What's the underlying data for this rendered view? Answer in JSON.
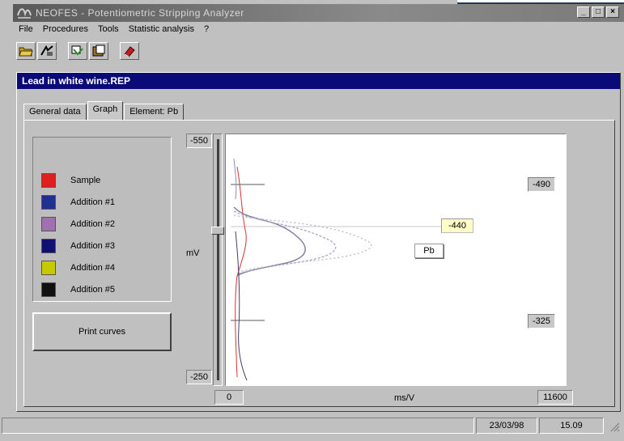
{
  "app": {
    "title": "NEOFES - Potentiometric Stripping Analyzer"
  },
  "window_controls": {
    "minimize": "_",
    "maximize": "□",
    "close": "×"
  },
  "menu": [
    "File",
    "Procedures",
    "Tools",
    "Statistic analysis",
    "?"
  ],
  "toolbar": {
    "icons": [
      "open-folder-icon",
      "scan-icon",
      "copy-icon",
      "paste-icon",
      "clear-icon"
    ]
  },
  "document": {
    "title": "Lead in white wine.REP",
    "tabs": [
      "General data",
      "Graph",
      "Element: Pb"
    ],
    "active_tab": "Graph"
  },
  "legend": {
    "items": [
      {
        "label": "Sample",
        "color": "#e02020"
      },
      {
        "label": "Addition #1",
        "color": "#1e3090"
      },
      {
        "label": "Addition #2",
        "color": "#a070b0"
      },
      {
        "label": "Addition #3",
        "color": "#101070"
      },
      {
        "label": "Addition #4",
        "color": "#c8c800"
      },
      {
        "label": "Addition #5",
        "color": "#101010"
      }
    ]
  },
  "print_button": "Print curves",
  "graph": {
    "y_top": "-550",
    "y_bottom": "-250",
    "y_axis_label": "mV",
    "x_start": "0",
    "x_end": "11600",
    "x_axis_label": "ms/V",
    "marker_upper": "-490",
    "marker_lower": "-325",
    "cursor_value": "-440",
    "element_label": "Pb"
  },
  "status": {
    "date": "23/03/98",
    "time": "15.09"
  }
}
